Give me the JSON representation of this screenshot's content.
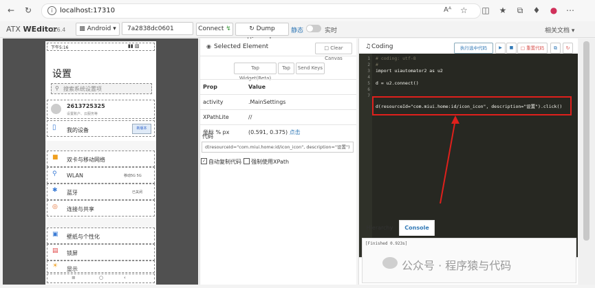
{
  "browser": {
    "url": "localhost:17310",
    "read_aloud": "Aᴬ"
  },
  "app": {
    "brand_prefix": "ATX ",
    "brand_main": "WEditor",
    "version": "0.6.4",
    "platform": "Android",
    "device_serial": "7a2838dc0601",
    "connect_label": "Connect",
    "dump_label": "Dump Hierarchy",
    "static_label": "静态",
    "realtime_label": "实时",
    "docs_label": "相关文档"
  },
  "phone": {
    "status_time": "下午5:16",
    "title": "设置",
    "search_placeholder": "搜索系统设置项",
    "account_name": "2613725325",
    "account_sub": "设置账户、云服务等",
    "my_device": "我的设备",
    "device_badge": "新版本",
    "items": [
      {
        "label": "双卡与移动网络",
        "right": ""
      },
      {
        "label": "WLAN",
        "right": "移动5G 5G"
      },
      {
        "label": "蓝牙",
        "right": "已关闭"
      },
      {
        "label": "连接与共享",
        "right": ""
      },
      {
        "label": "壁纸与个性化",
        "right": ""
      },
      {
        "label": "锁屏",
        "right": ""
      },
      {
        "label": "显示",
        "right": ""
      }
    ]
  },
  "selected": {
    "header": "Selected Element",
    "clear_label": "Clear Canvas",
    "tap_widget_label": "Tap Widget(Beta)",
    "tap_label": "Tap",
    "send_keys_label": "Send Keys",
    "col_prop": "Prop",
    "col_value": "Value",
    "rows": [
      {
        "prop": "activity",
        "value": ".MainSettings"
      },
      {
        "prop": "XPathLite",
        "value": "//"
      },
      {
        "prop": "坐标 % px",
        "value": "(0.591, 0.375)"
      }
    ],
    "click_link": "点击",
    "code_label": "代码",
    "code_value": "d(resourceId=\"com.miui.home:id/icon_icon\", description=\"设置\")",
    "auto_copy_label": "自动复制代码",
    "force_xpath_label": "强制使用XPath"
  },
  "coding": {
    "header": "Coding",
    "run_selected_label": "执行选中代码",
    "reset_label": "重置代码",
    "lines": [
      "# coding: utf-8",
      "#",
      "import uiautomator2 as u2",
      "",
      "d = u2.connect()",
      "",
      "d(resourceId=\"com.miui.home:id/icon_icon\", description=\"设置\").click()"
    ],
    "line_numbers": [
      "1",
      "2",
      "3",
      "4",
      "5",
      "6",
      "7"
    ],
    "tab_hierarchy": "Hierarchy",
    "tab_console": "Console",
    "console_text": "[Finished 0.923s]"
  },
  "watermark": "公众号 · 程序猿与代码",
  "colors": {
    "accent": "#337ab7",
    "highlight_red": "#e0201c",
    "editor_bg": "#272822"
  }
}
